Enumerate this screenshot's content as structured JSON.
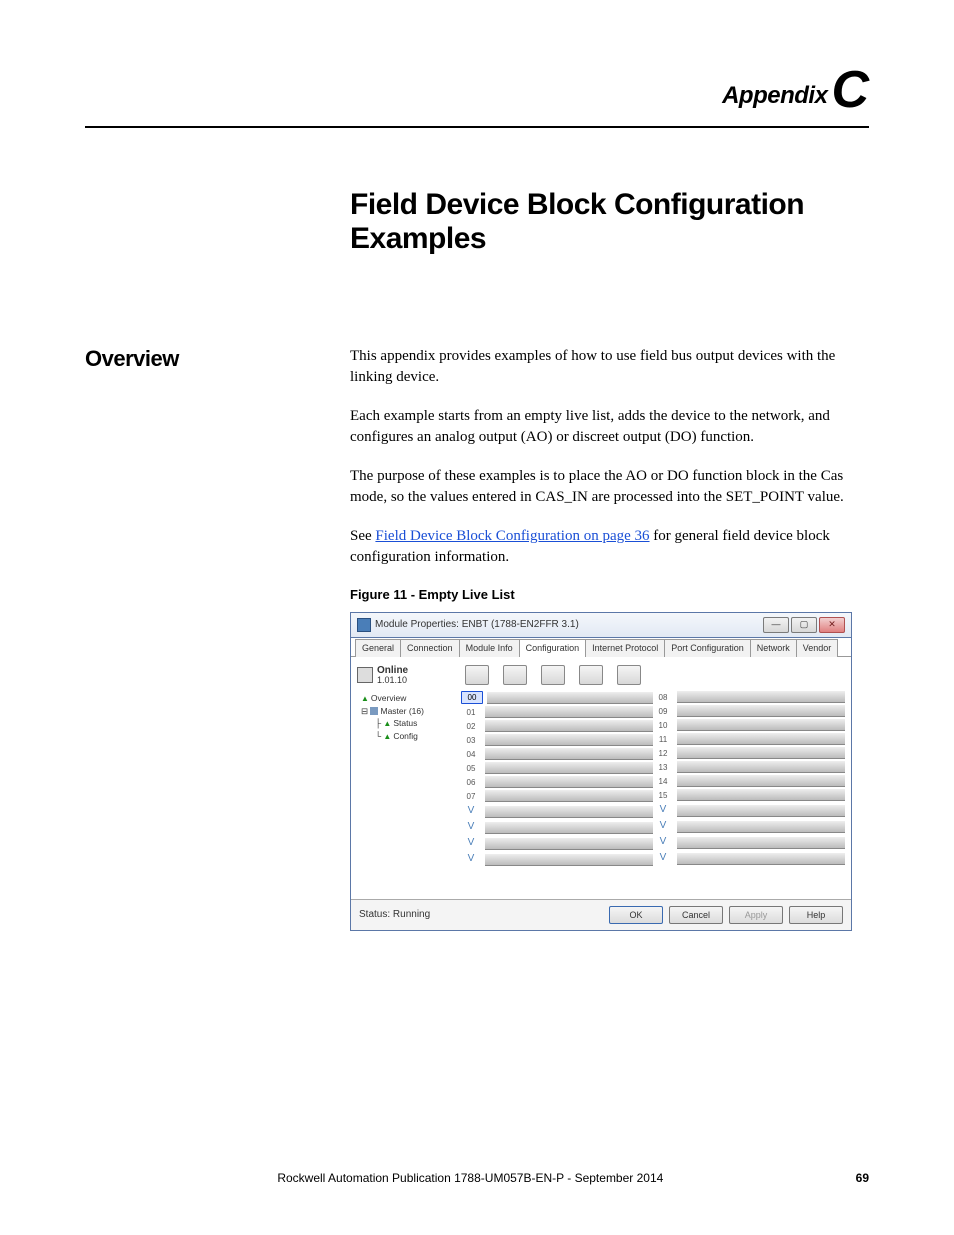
{
  "header": {
    "label": "Appendix",
    "letter": "C"
  },
  "title": "Field Device Block Configuration Examples",
  "section_heading": "Overview",
  "p1": "This appendix provides examples of how to use field bus output devices with the linking device.",
  "p2": "Each example starts from an empty live list, adds the device to the network, and configures an analog output (AO) or discreet output (DO) function.",
  "p3": "The purpose of these examples is to place the AO or DO function block in the Cas mode, so the values entered in CAS_IN are processed into the SET_POINT value.",
  "p4_pre": "See ",
  "p4_link": "Field Device Block Configuration on page 36",
  "p4_post": " for general field device block configuration information.",
  "figure_caption": "Figure 11 - Empty Live List",
  "window": {
    "title": "Module Properties: ENBT (1788-EN2FFR 3.1)",
    "btn_min": "—",
    "btn_max": "▢",
    "btn_close": "✕",
    "tabs": [
      "General",
      "Connection",
      "Module Info",
      "Configuration",
      "Internet Protocol",
      "Port Configuration",
      "Network",
      "Vendor"
    ],
    "active_tab": "Configuration",
    "online_label": "Online",
    "online_ver": "1.01.10",
    "tree": [
      "Overview",
      "Master (16)",
      "Status",
      "Config"
    ],
    "slots_left": [
      "00",
      "01",
      "02",
      "03",
      "04",
      "05",
      "06",
      "07",
      "V",
      "V",
      "V",
      "V"
    ],
    "slots_right": [
      "08",
      "09",
      "10",
      "11",
      "12",
      "13",
      "14",
      "15",
      "V",
      "V",
      "V",
      "V"
    ],
    "selected_slot": "00",
    "status_label": "Status: Running",
    "buttons": {
      "ok": "OK",
      "cancel": "Cancel",
      "apply": "Apply",
      "help": "Help"
    }
  },
  "footer": {
    "pub": "Rockwell Automation Publication 1788-UM057B-EN-P - September 2014",
    "page": "69"
  }
}
